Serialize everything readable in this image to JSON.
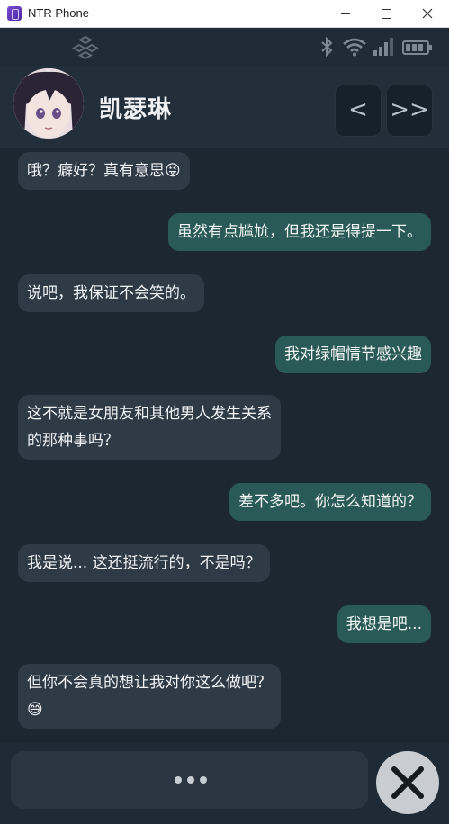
{
  "window": {
    "title": "NTR Phone"
  },
  "header": {
    "contact_name": "凯瑟琳",
    "prev_label": "<",
    "skip_label": ">>"
  },
  "messages": [
    {
      "side": "in",
      "text": "哦？癖好？真有意思",
      "emoji": "😜"
    },
    {
      "side": "out",
      "text": "虽然有点尴尬，但我还是得提一下。"
    },
    {
      "side": "in",
      "text": "说吧，我保证不会笑的。"
    },
    {
      "side": "out",
      "text": "我对绿帽情节感兴趣"
    },
    {
      "side": "in",
      "line1": "这不就是女朋友和其他男人发生关系",
      "line2": "的那种事吗？"
    },
    {
      "side": "out",
      "text": "差不多吧。你怎么知道的？"
    },
    {
      "side": "in",
      "text": "我是说... 这还挺流行的，不是吗？"
    },
    {
      "side": "out",
      "text": "我想是吧..."
    },
    {
      "side": "in",
      "line1": "但你不会真的想让我对你这么做吧？",
      "emoji": "😅"
    }
  ],
  "icons": {
    "status": [
      "logo-icon",
      "bluetooth-icon",
      "wifi-icon",
      "signal-icon",
      "battery-icon"
    ],
    "close": "close-icon"
  },
  "colors": {
    "background": "#1c2731",
    "incoming_bubble": "#2e3a46",
    "outgoing_bubble": "#2a5a57",
    "close_button": "#c9cdd1"
  }
}
